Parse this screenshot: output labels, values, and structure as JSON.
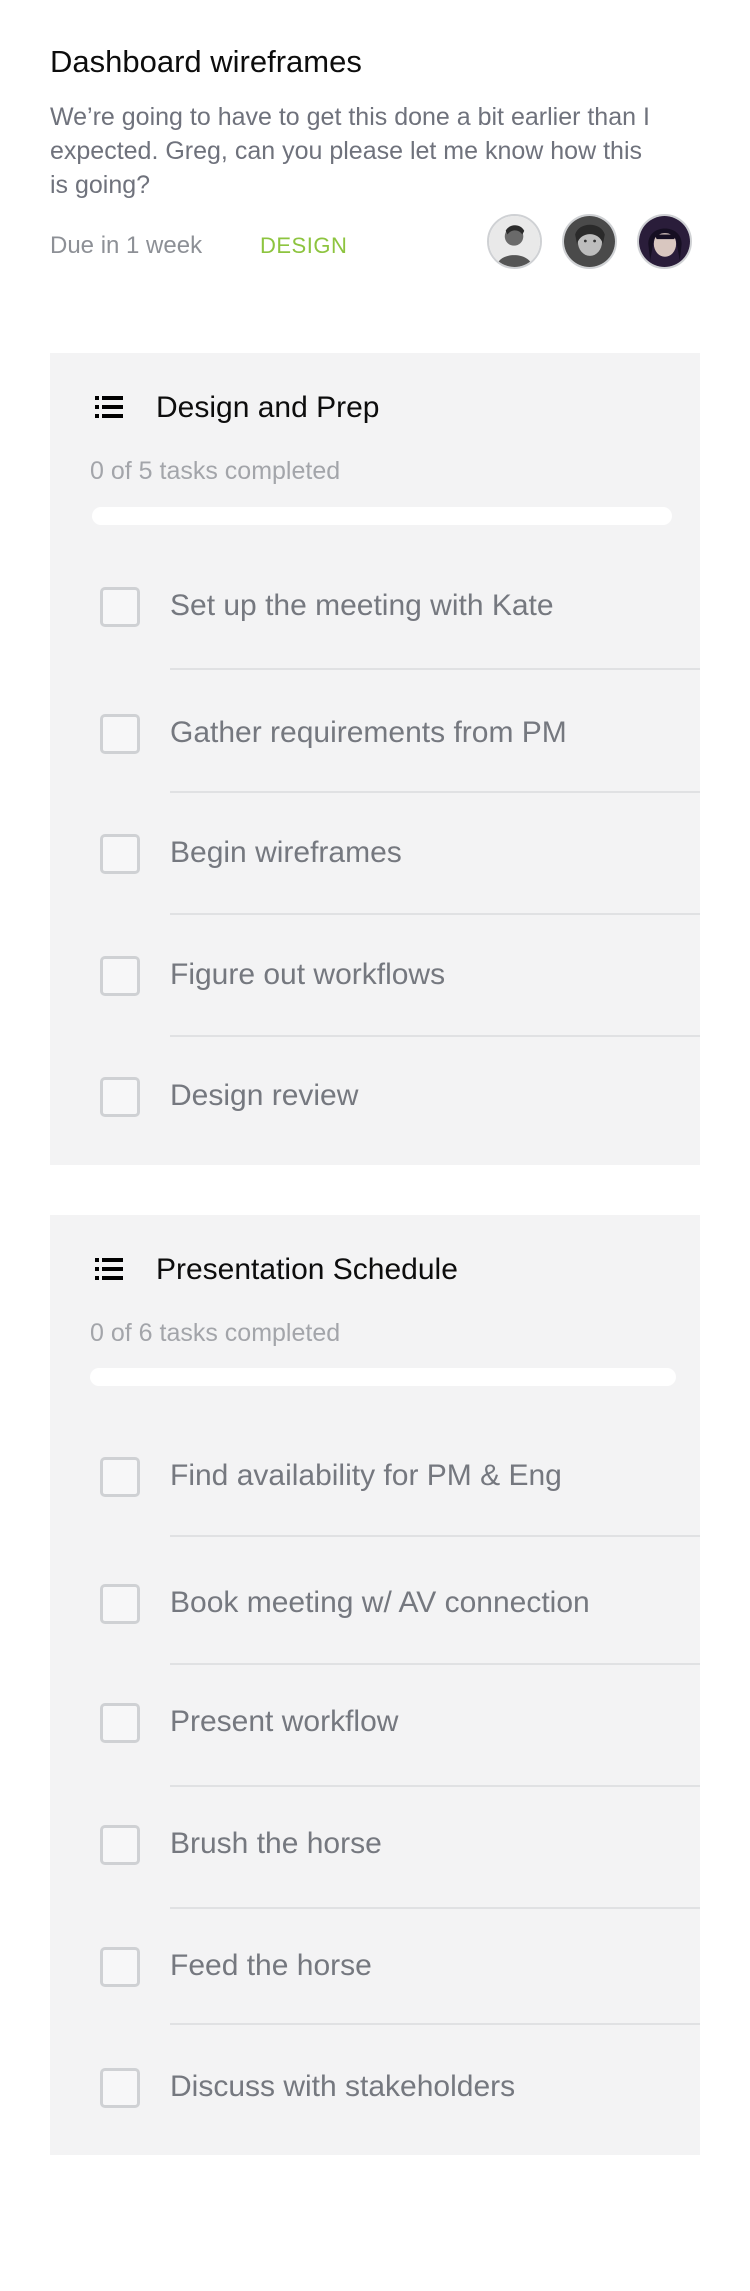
{
  "header": {
    "title": "Dashboard wireframes",
    "description": "We’re going to have to get this done a bit earlier than I expected. Greg, can you please let me know how this is going?",
    "due": "Due in 1 week",
    "tag": "DESIGN",
    "tag_color": "#8dc43f",
    "avatars": [
      "avatar-1",
      "avatar-2",
      "avatar-3"
    ]
  },
  "checklists": [
    {
      "title": "Design and Prep",
      "icon": "list-icon",
      "progress_text": "0 of 5 tasks completed",
      "progress_fraction": 0,
      "tasks": [
        {
          "label": "Set up the meeting with Kate",
          "done": false
        },
        {
          "label": "Gather requirements from PM",
          "done": false
        },
        {
          "label": "Begin wireframes",
          "done": false
        },
        {
          "label": "Figure out workflows",
          "done": false
        },
        {
          "label": "Design review",
          "done": false
        }
      ]
    },
    {
      "title": "Presentation Schedule",
      "icon": "list-icon",
      "progress_text": "0 of 6 tasks completed",
      "progress_fraction": 0,
      "tasks": [
        {
          "label": "Find availability for PM & Eng",
          "done": false
        },
        {
          "label": "Book meeting w/ AV connection",
          "done": false
        },
        {
          "label": "Present workflow",
          "done": false
        },
        {
          "label": "Brush the horse",
          "done": false
        },
        {
          "label": "Feed the horse",
          "done": false
        },
        {
          "label": "Discuss with stakeholders",
          "done": false
        }
      ]
    }
  ]
}
